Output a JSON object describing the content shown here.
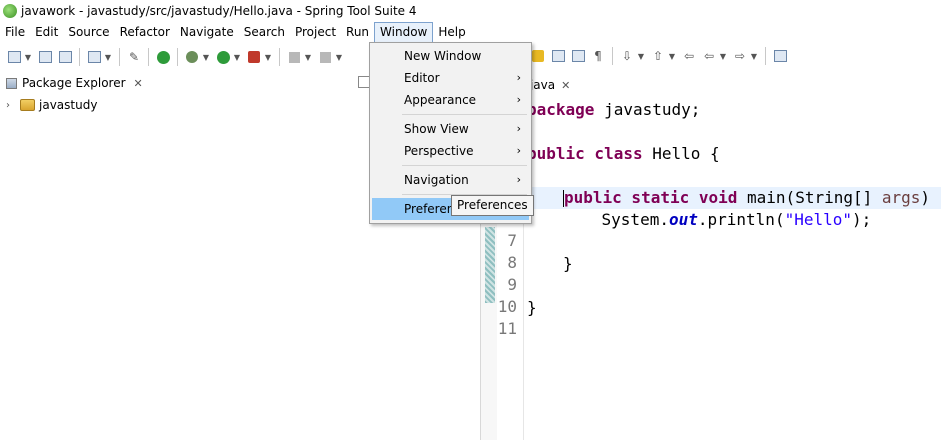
{
  "window": {
    "title": "javawork - javastudy/src/javastudy/Hello.java - Spring Tool Suite 4"
  },
  "menubar": [
    "File",
    "Edit",
    "Source",
    "Refactor",
    "Navigate",
    "Search",
    "Project",
    "Run",
    "Window",
    "Help"
  ],
  "package_explorer": {
    "title": "Package Explorer",
    "project": "javastudy"
  },
  "editor": {
    "tab_label": "o.java",
    "line_numbers": [
      "7",
      "8",
      "9",
      "10",
      "11"
    ],
    "code": {
      "line1_kw": "package",
      "line1_rest": " javastudy;",
      "line3_kw": "public class",
      "line3_rest": " Hello {",
      "line5_kw": "public static void",
      "line5_main": " main(String[] ",
      "line5_param": "args",
      "line5_end": ") {",
      "line6_a": "    System.",
      "line6_field": "out",
      "line6_b": ".println(",
      "line6_str": "\"Hello\"",
      "line6_c": ");",
      "line8": "}",
      "line10": "}"
    }
  },
  "window_menu": {
    "items": [
      "New Window",
      "Editor",
      "Appearance",
      "Show View",
      "Perspective",
      "Navigation",
      "Preferences"
    ],
    "submenu_arrow": "›"
  },
  "tooltip": {
    "text": "Preferences"
  },
  "icons": [
    "new-icon",
    "save-icon",
    "save-all-icon",
    "console-icon",
    "debug-icon",
    "run-icon",
    "external-tools-icon",
    "stop-icon",
    "build-icon",
    "pilcrow-icon",
    "back-icon",
    "forward-icon"
  ],
  "colors": {
    "keyword": "#7f0055",
    "string": "#2a00ff",
    "field": "#0000c0",
    "menu_hover": "#91c9f7"
  }
}
